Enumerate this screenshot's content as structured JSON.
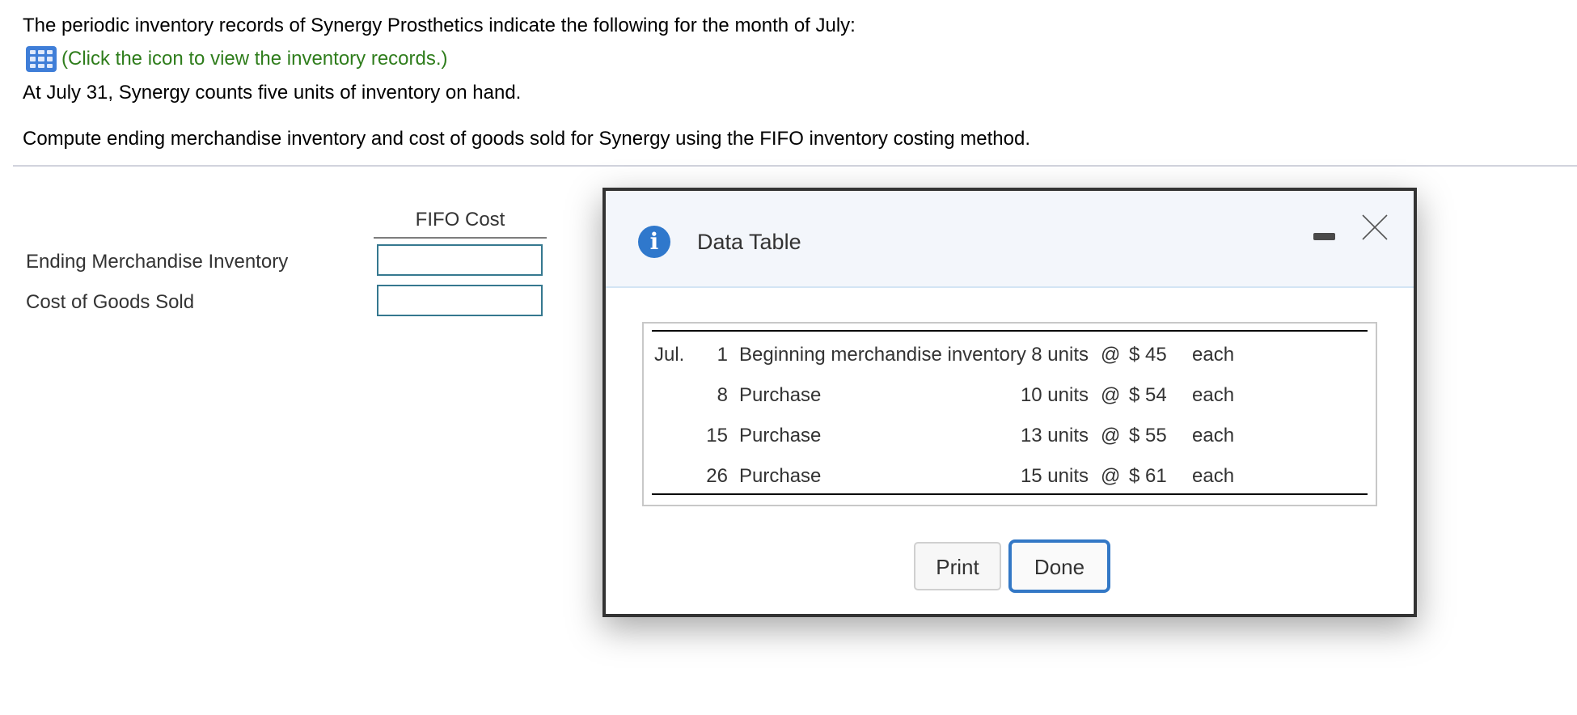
{
  "question": {
    "line1": "The periodic inventory records of Synergy Prosthetics indicate the following for the month of July:",
    "link_icon": "table-grid-icon",
    "link_text": "(Click the icon to view the inventory records.)",
    "line3": "At July 31, Synergy counts five units of inventory on hand.",
    "line4": "Compute ending merchandise inventory and cost of goods sold for Synergy using the FIFO inventory costing method."
  },
  "answer_form": {
    "column_header": "FIFO Cost",
    "rows": [
      {
        "label": "Ending Merchandise Inventory",
        "value": ""
      },
      {
        "label": "Cost of Goods Sold",
        "value": ""
      }
    ]
  },
  "modal": {
    "title": "Data Table",
    "header_icon": "info-icon",
    "minimize_icon": "minimize-icon",
    "close_icon": "close-icon",
    "info_glyph": "i",
    "table": {
      "rows": [
        {
          "month": "Jul.",
          "day": "1",
          "description": "Beginning merchandise inventory",
          "units": "8 units",
          "at": "@",
          "cost": "$ 45",
          "each": "each"
        },
        {
          "month": "",
          "day": "8",
          "description": "Purchase",
          "units": "10 units",
          "at": "@",
          "cost": "$ 54",
          "each": "each"
        },
        {
          "month": "",
          "day": "15",
          "description": "Purchase",
          "units": "13 units",
          "at": "@",
          "cost": "$ 55",
          "each": "each"
        },
        {
          "month": "",
          "day": "26",
          "description": "Purchase",
          "units": "15 units",
          "at": "@",
          "cost": "$ 61",
          "each": "each"
        }
      ]
    },
    "buttons": {
      "print": "Print",
      "done": "Done"
    }
  },
  "colors": {
    "link_green": "#2f7d1c",
    "accent_blue": "#3378c6",
    "input_border": "#35788f",
    "modal_border": "#333333",
    "modal_header_bg": "#f3f6fb"
  }
}
